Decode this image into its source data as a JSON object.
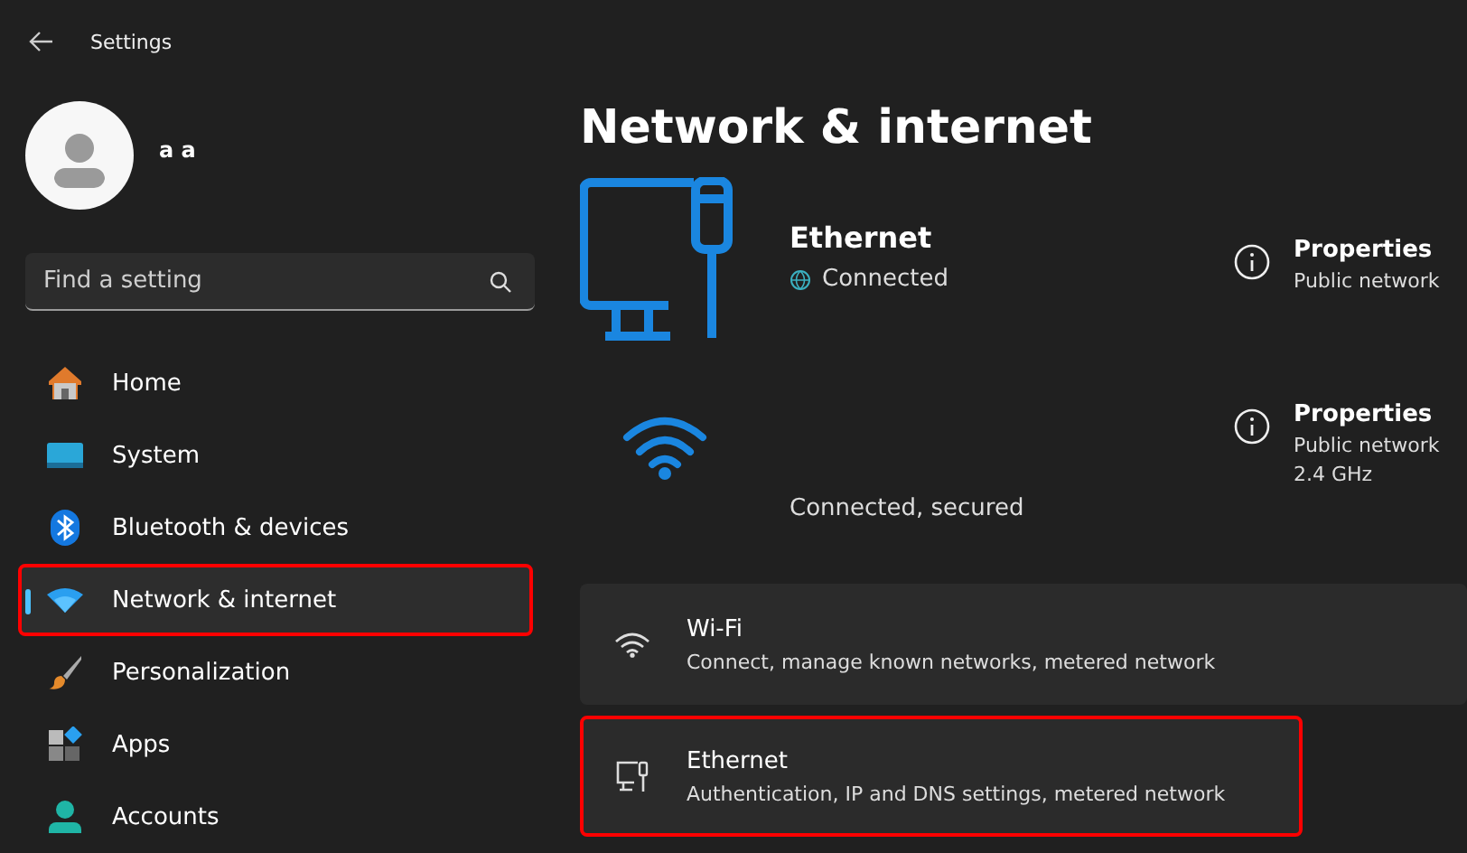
{
  "window": {
    "title": "Settings"
  },
  "user": {
    "name": "a a"
  },
  "search": {
    "placeholder": "Find a setting"
  },
  "nav": [
    {
      "label": "Home",
      "kind": "home",
      "selected": false,
      "highlighted": false
    },
    {
      "label": "System",
      "kind": "system",
      "selected": false,
      "highlighted": false
    },
    {
      "label": "Bluetooth & devices",
      "kind": "bluetooth",
      "selected": false,
      "highlighted": false
    },
    {
      "label": "Network & internet",
      "kind": "network",
      "selected": true,
      "highlighted": true
    },
    {
      "label": "Personalization",
      "kind": "brush",
      "selected": false,
      "highlighted": false
    },
    {
      "label": "Apps",
      "kind": "apps",
      "selected": false,
      "highlighted": false
    },
    {
      "label": "Accounts",
      "kind": "accounts",
      "selected": false,
      "highlighted": false
    }
  ],
  "page_title": "Network & internet",
  "connections": [
    {
      "kind": "ethernet",
      "name": "Ethernet",
      "status": "Connected",
      "properties": "Properties",
      "details": [
        "Public network"
      ]
    },
    {
      "kind": "wifi",
      "status": "Connected, secured",
      "properties": "Properties",
      "details": [
        "Public network",
        "2.4 GHz"
      ]
    }
  ],
  "settings": [
    {
      "kind": "wifi",
      "title": "Wi-Fi",
      "description": "Connect, manage known networks, metered network",
      "highlighted": false
    },
    {
      "kind": "ethernet",
      "title": "Ethernet",
      "description": "Authentication, IP and DNS settings, metered network",
      "highlighted": true
    }
  ]
}
